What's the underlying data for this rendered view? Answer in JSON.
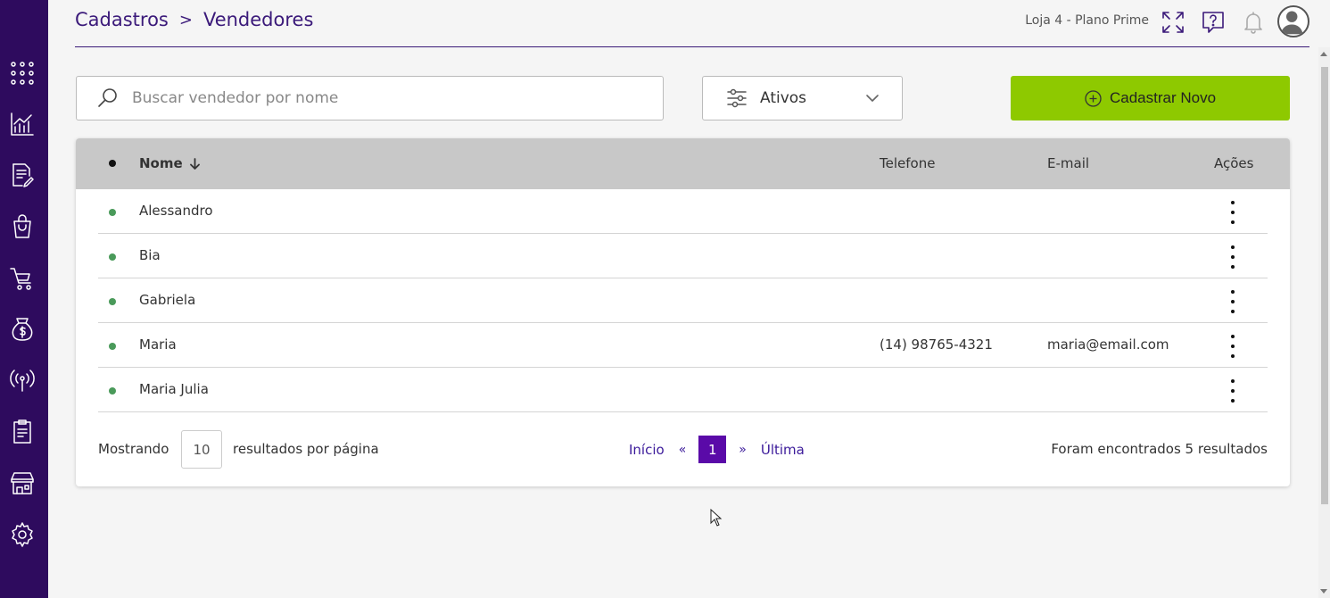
{
  "breadcrumb": {
    "parent": "Cadastros",
    "separator": ">",
    "current": "Vendedores"
  },
  "header": {
    "store_label": "Loja 4 - Plano Prime"
  },
  "sidebar": {
    "items": [
      {
        "name": "apps-grid-icon"
      },
      {
        "name": "chart-icon"
      },
      {
        "name": "document-edit-icon"
      },
      {
        "name": "shopping-bag-icon"
      },
      {
        "name": "cart-icon"
      },
      {
        "name": "money-bag-icon"
      },
      {
        "name": "broadcast-icon"
      },
      {
        "name": "clipboard-icon"
      },
      {
        "name": "store-icon"
      },
      {
        "name": "gear-icon"
      }
    ]
  },
  "search": {
    "placeholder": "Buscar vendedor por nome",
    "value": ""
  },
  "filter": {
    "selected": "Ativos"
  },
  "new_button": {
    "label": "Cadastrar Novo"
  },
  "colors": {
    "sidebar": "#2e0b5e",
    "accent": "#3b1a7a",
    "primary_button": "#8ec900",
    "status_active": "#4a9a5a",
    "page_active": "#5a0aa8"
  },
  "table": {
    "columns": {
      "name": "Nome",
      "phone": "Telefone",
      "email": "E-mail",
      "actions": "Ações"
    },
    "rows": [
      {
        "name": "Alessandro",
        "phone": "",
        "email": ""
      },
      {
        "name": "Bia",
        "phone": "",
        "email": ""
      },
      {
        "name": "Gabriela",
        "phone": "",
        "email": ""
      },
      {
        "name": "Maria",
        "phone": "(14) 98765-4321",
        "email": "maria@email.com"
      },
      {
        "name": "Maria Julia",
        "phone": "",
        "email": ""
      }
    ]
  },
  "footer": {
    "showing": "Mostrando",
    "per_page": "10",
    "per_page_label": "resultados por página",
    "first": "Início",
    "prev": "«",
    "current_page": "1",
    "next": "»",
    "last": "Última",
    "results": "Foram encontrados 5 resultados"
  }
}
